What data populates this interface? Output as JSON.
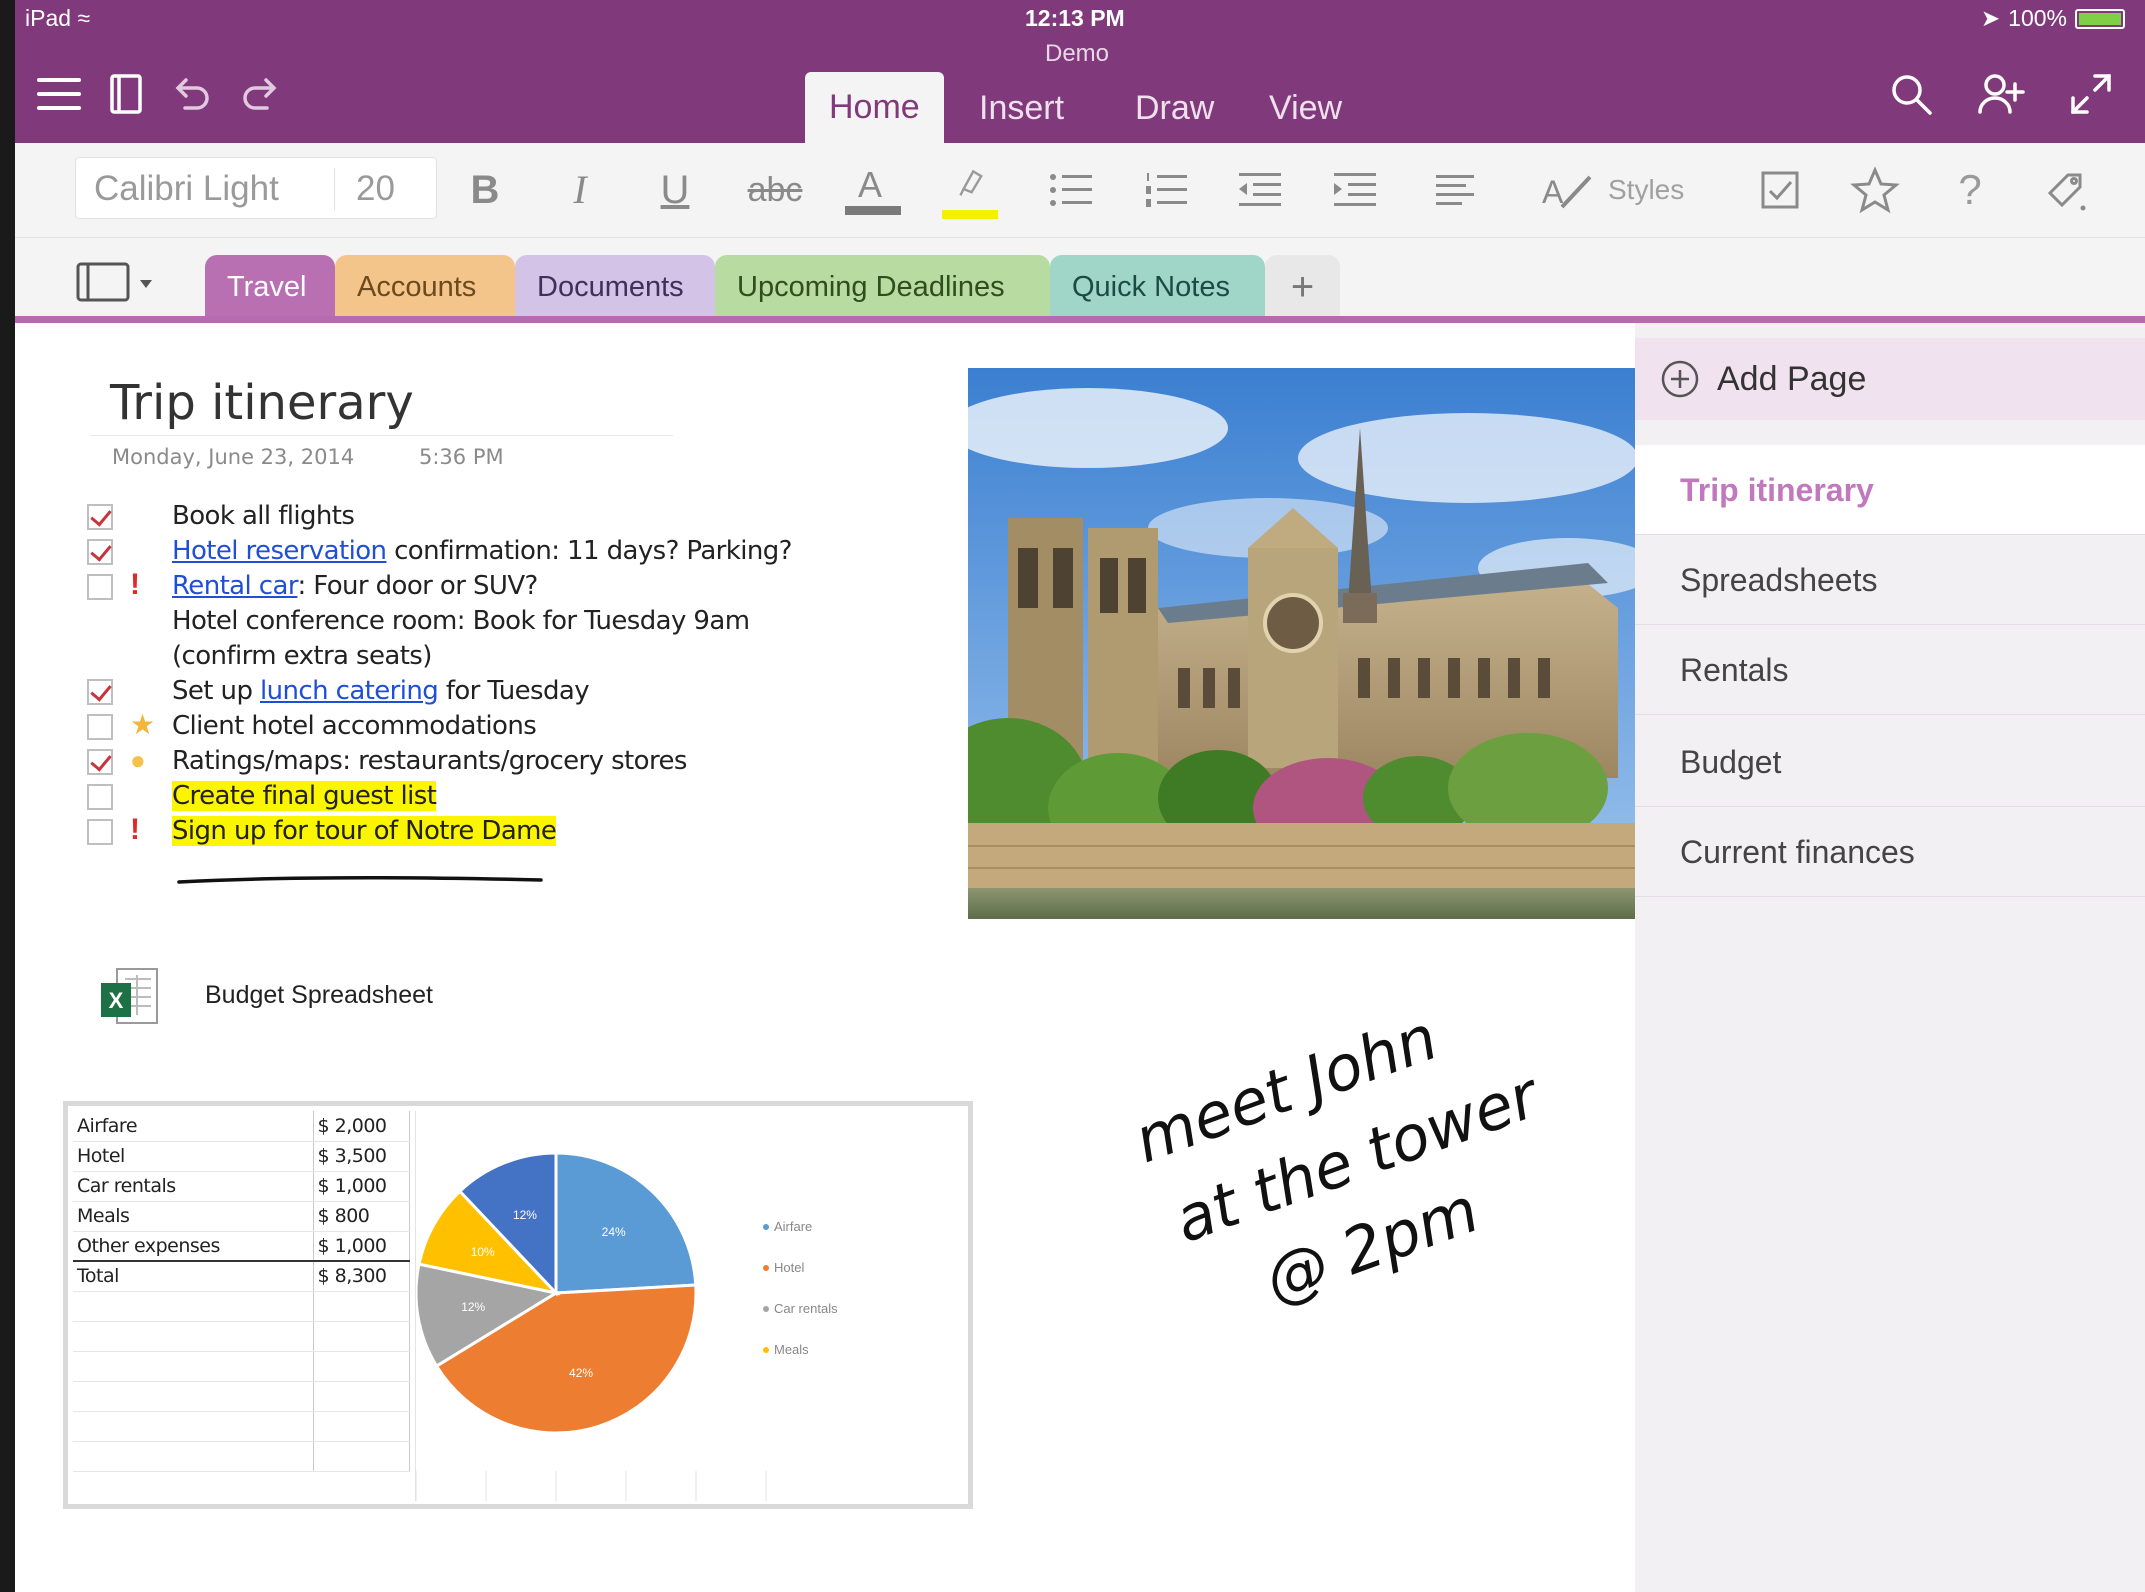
{
  "status": {
    "device": "iPad",
    "time": "12:13 PM",
    "battery": "100%"
  },
  "document_title": "Demo",
  "tabs": [
    {
      "label": "Home",
      "active": true
    },
    {
      "label": "Insert"
    },
    {
      "label": "Draw"
    },
    {
      "label": "View"
    }
  ],
  "ribbon": {
    "font_name": "Calibri Light",
    "font_size": "20",
    "styles_label": "Styles",
    "bold": "B",
    "italic": "I",
    "underline": "U",
    "strike": "abc",
    "font_color_glyph": "A",
    "help_glyph": "?"
  },
  "sections": [
    {
      "label": "Travel",
      "color": "#b870b3",
      "active": true
    },
    {
      "label": "Accounts",
      "color": "#f4c58a"
    },
    {
      "label": "Documents",
      "color": "#d3c3e6"
    },
    {
      "label": "Upcoming Deadlines",
      "color": "#b7dba0"
    },
    {
      "label": "Quick Notes",
      "color": "#9fd6c8"
    },
    {
      "label": "+"
    }
  ],
  "page": {
    "title": "Trip itinerary",
    "date": "Monday, June 23, 2014",
    "time": "5:36 PM",
    "todos": [
      {
        "checked": true,
        "tag": "",
        "parts": [
          {
            "t": "Book all flights"
          }
        ]
      },
      {
        "checked": true,
        "tag": "",
        "parts": [
          {
            "t": "Hotel reservation",
            "link": true
          },
          {
            "t": " confirmation: 11 days? Parking?"
          }
        ]
      },
      {
        "checked": false,
        "tag": "!",
        "parts": [
          {
            "t": "Rental car",
            "link": true
          },
          {
            "t": ": Four door or SUV?"
          }
        ]
      },
      {
        "checked": null,
        "tag": "",
        "parts": [
          {
            "t": "Hotel conference room: Book for Tuesday 9am"
          }
        ]
      },
      {
        "checked": null,
        "tag": "",
        "parts": [
          {
            "t": "(confirm extra seats)"
          }
        ]
      },
      {
        "checked": true,
        "tag": "",
        "parts": [
          {
            "t": "Set up "
          },
          {
            "t": "lunch catering",
            "link": true
          },
          {
            "t": " for Tuesday"
          }
        ]
      },
      {
        "checked": false,
        "tag": "star",
        "parts": [
          {
            "t": "Client hotel accommodations"
          }
        ]
      },
      {
        "checked": true,
        "tag": "idea",
        "parts": [
          {
            "t": "Ratings/maps: restaurants/grocery stores"
          }
        ]
      },
      {
        "checked": false,
        "tag": "",
        "parts": [
          {
            "t": "Create final guest list",
            "highlight": true
          }
        ]
      },
      {
        "checked": false,
        "tag": "!",
        "parts": [
          {
            "t": "Sign up for tour of Notre Dame",
            "highlight": true
          }
        ]
      }
    ],
    "attachment": "Budget Spreadsheet",
    "handwriting": [
      "meet John",
      "at the tower",
      "@ 2pm"
    ]
  },
  "spreadsheet": {
    "rows": [
      {
        "label": "Airfare",
        "value": "$ 2,000"
      },
      {
        "label": "Hotel",
        "value": "$ 3,500"
      },
      {
        "label": "Car rentals",
        "value": "$ 1,000"
      },
      {
        "label": "Meals",
        "value": "$ 800"
      },
      {
        "label": "Other expenses",
        "value": "$ 1,000"
      },
      {
        "label": "Total",
        "value": "$ 8,300"
      }
    ]
  },
  "chart_data": {
    "type": "pie",
    "categories": [
      "Airfare",
      "Hotel",
      "Car rentals",
      "Meals",
      "Other expenses"
    ],
    "values": [
      2000,
      3500,
      1000,
      800,
      1000
    ],
    "slice_labels": [
      "24%",
      "42%",
      "12%",
      "10%",
      "12%"
    ],
    "colors": [
      "#5b9bd5",
      "#ed7d31",
      "#a5a5a5",
      "#ffc000",
      "#4472c4"
    ],
    "legend": [
      "Airfare",
      "Hotel",
      "Car rentals",
      "Meals"
    ],
    "legend_position": "right"
  },
  "page_list": {
    "add_label": "Add Page",
    "items": [
      {
        "label": "Trip itinerary",
        "active": true
      },
      {
        "label": "Spreadsheets"
      },
      {
        "label": "Rentals"
      },
      {
        "label": "Budget"
      },
      {
        "label": "Current finances"
      }
    ]
  },
  "colors": {
    "brand": "#80397b",
    "section_active": "#b66ab1",
    "link": "#1f4fd6",
    "highlight": "#fbf500",
    "flag": "#e02a2a"
  }
}
